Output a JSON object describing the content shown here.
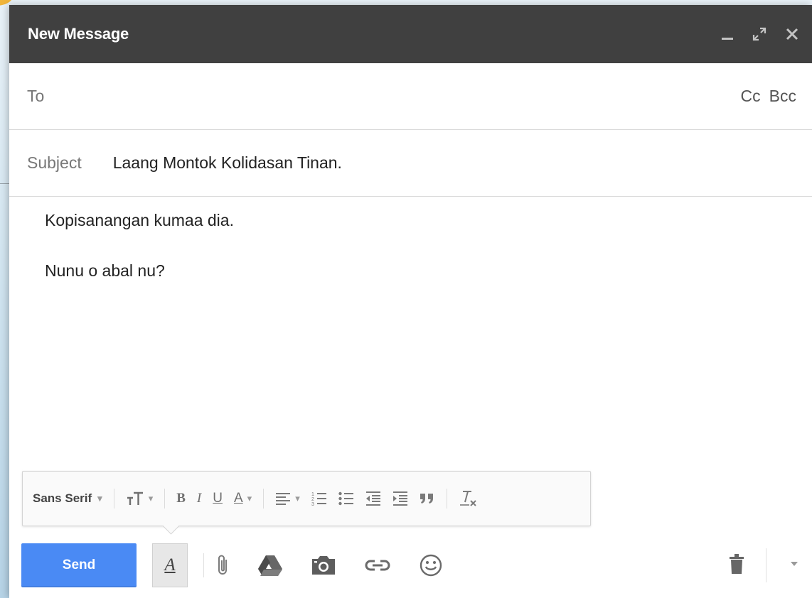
{
  "window": {
    "title": "New Message",
    "icons": [
      "minimize-icon",
      "expand-icon",
      "close-icon"
    ]
  },
  "to": {
    "label": "To",
    "cc": "Cc",
    "bcc": "Bcc"
  },
  "subject": {
    "label": "Subject",
    "value": "Laang Montok Kolidasan Tinan."
  },
  "body": {
    "lines": [
      "Kopisanangan kumaa dia.",
      "Nunu o abal nu?"
    ]
  },
  "format_toolbar": {
    "font": "Sans Serif",
    "bold": "B",
    "italic": "I",
    "underline": "U",
    "text_color": "A"
  },
  "bottom_bar": {
    "send_label": "Send",
    "format_toggle": "A"
  },
  "colors": {
    "titlebar": "#404040",
    "send": "#4a8af4"
  }
}
